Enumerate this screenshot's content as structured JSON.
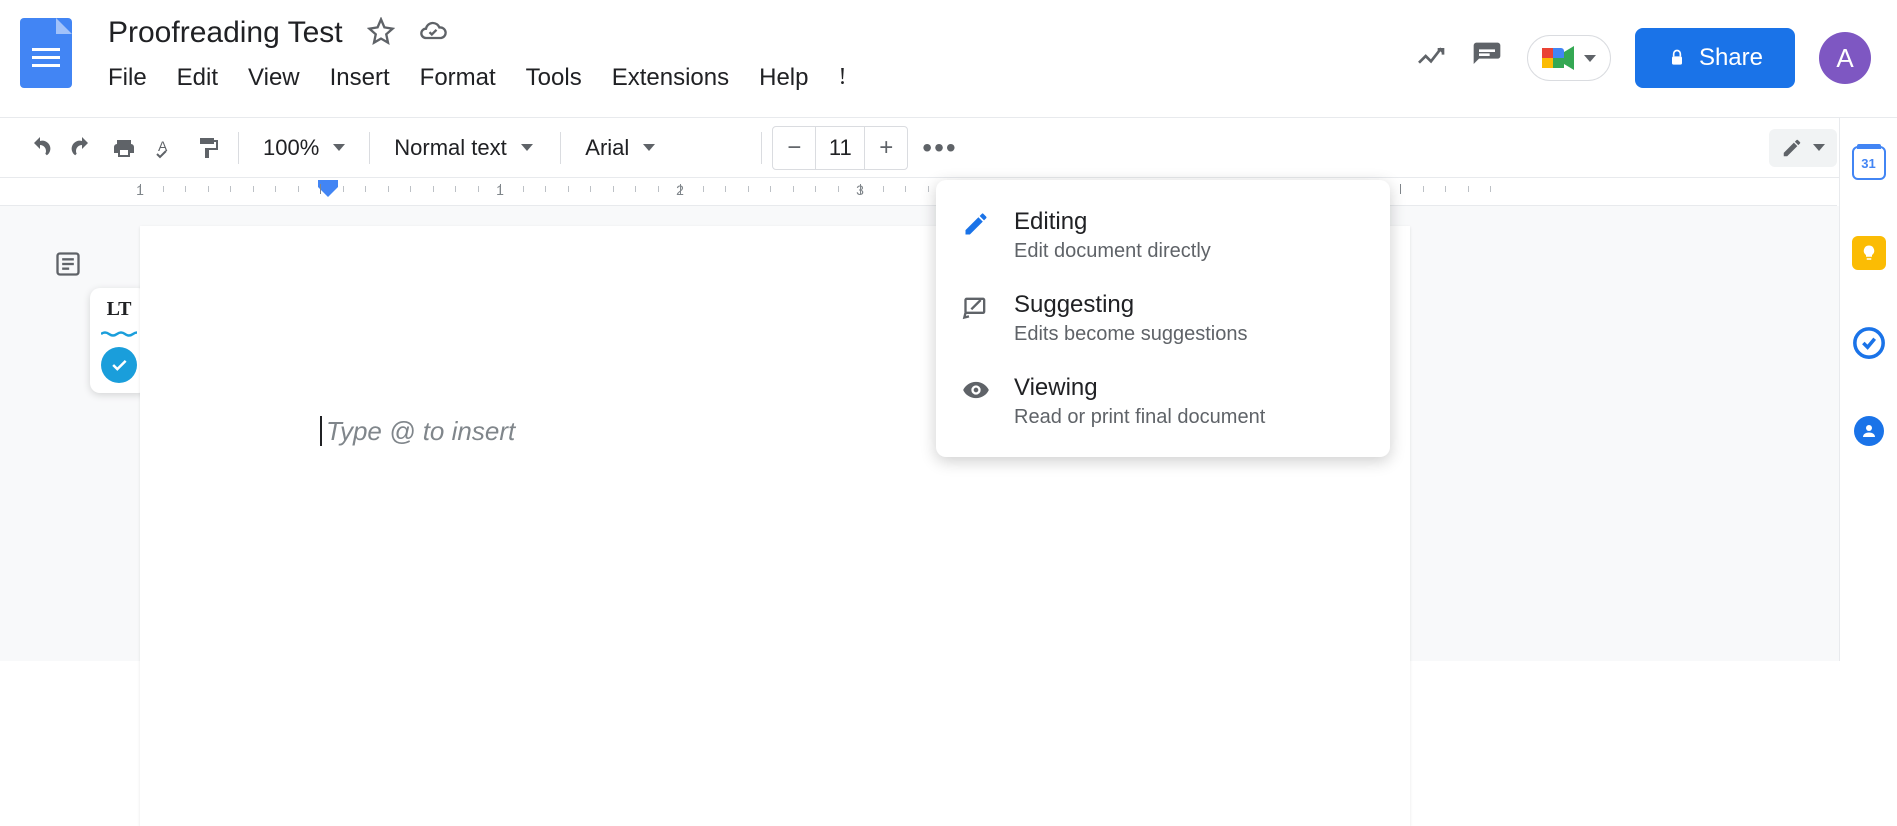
{
  "header": {
    "title": "Proofreading Test",
    "share_label": "Share",
    "avatar_initial": "A"
  },
  "menubar": {
    "file": "File",
    "edit": "Edit",
    "view": "View",
    "insert": "Insert",
    "format": "Format",
    "tools": "Tools",
    "extensions": "Extensions",
    "help": "Help",
    "last_edit": "!"
  },
  "toolbar": {
    "zoom": "100%",
    "style": "Normal text",
    "font": "Arial",
    "font_size": "11"
  },
  "ruler": {
    "marks": [
      "1",
      "1",
      "2",
      "3"
    ]
  },
  "document": {
    "placeholder": "Type @ to insert"
  },
  "mode_menu": {
    "editing": {
      "title": "Editing",
      "sub": "Edit document directly"
    },
    "suggesting": {
      "title": "Suggesting",
      "sub": "Edits become suggestions"
    },
    "viewing": {
      "title": "Viewing",
      "sub": "Read or print final document"
    }
  },
  "sidepanel": {
    "calendar_day": "31"
  }
}
